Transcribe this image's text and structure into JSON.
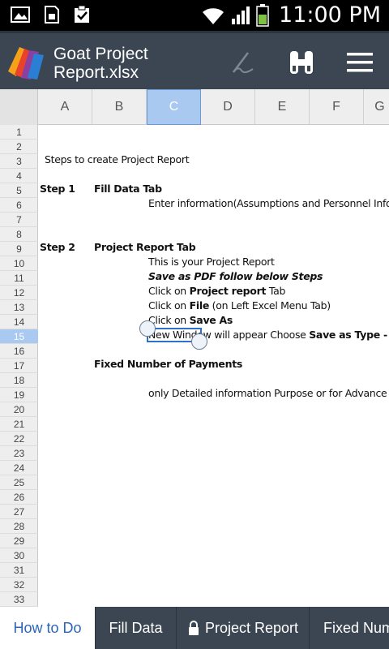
{
  "status": {
    "time": "11:00 PM"
  },
  "app": {
    "title_line1": "Goat Project",
    "title_line2": "Report.xlsx"
  },
  "columns": [
    "A",
    "B",
    "C",
    "D",
    "E",
    "F",
    "G"
  ],
  "selected_column": "C",
  "rows": [
    "1",
    "2",
    "3",
    "4",
    "5",
    "6",
    "7",
    "8",
    "9",
    "10",
    "11",
    "12",
    "13",
    "14",
    "15",
    "16",
    "17",
    "18",
    "19",
    "20",
    "21",
    "22",
    "23",
    "24",
    "25",
    "26",
    "27",
    "28",
    "29",
    "30",
    "31",
    "32",
    "33"
  ],
  "selected_row": "15",
  "cells": {
    "r3_title": "Steps to create Project Report",
    "r5_step": "Step 1",
    "r5_label": "Fill Data Tab",
    "r6_text": "Enter information(Assumptions and Personnel Inform",
    "r9_step": "Step 2",
    "r9_label": "Project Report Tab",
    "r10_text": "This is your Project Report",
    "r11_text": "Save as PDF follow below Steps",
    "r12_pre": "Click on ",
    "r12_bold": "Project report",
    "r12_post": " Tab",
    "r13_pre": "Click on ",
    "r13_bold": "File",
    "r13_post": " (on Left Excel Menu Tab)",
    "r14_pre": "Click on ",
    "r14_bold": "Save As",
    "r15_pre": "New Window will appear Choose ",
    "r15_bold": "Save as Type - PDF",
    "r17_label": "Fixed Number of Payments",
    "r19_text": "only Detailed information Purpose or for Advance Use"
  },
  "tabs": [
    {
      "label": "How to Do",
      "active": true
    },
    {
      "label": "Fill Data",
      "active": false
    },
    {
      "label": "Project Report",
      "active": false,
      "locked": true
    },
    {
      "label": "Fixed Num",
      "active": false
    }
  ],
  "icons": [
    "gallery-icon",
    "sd-card-icon",
    "clipboard-check-icon",
    "wifi-icon",
    "signal-icon",
    "battery-icon",
    "app-logo-icon",
    "pen-icon",
    "binoculars-icon",
    "menu-icon",
    "lock-icon"
  ],
  "colors": {
    "appbar": "#3b4652",
    "selection": "#2f6fce",
    "active_tab_text": "#2a66b8"
  }
}
